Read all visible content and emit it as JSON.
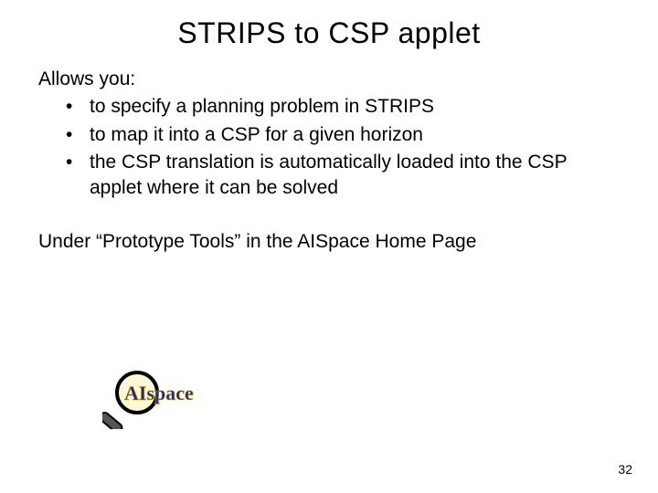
{
  "title": "STRIPS to CSP applet",
  "intro": "Allows you:",
  "bullets": [
    "to specify a planning problem in STRIPS",
    "to map it into a CSP for a given horizon",
    "the CSP translation is automatically loaded into the CSP applet where it can be solved"
  ],
  "under": "Under “Prototype Tools” in the AISpace Home Page",
  "logo_text": "AIspace",
  "page_number": "32"
}
